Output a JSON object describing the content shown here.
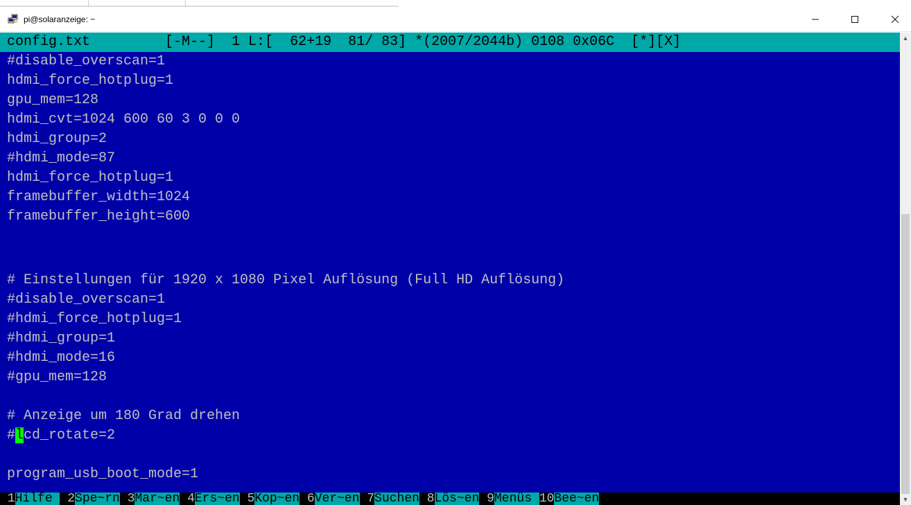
{
  "window": {
    "title": "pi@solaranzeige: ~",
    "app_icon": "putty-icon",
    "buttons": {
      "minimize": "—",
      "maximize": "☐",
      "close": "✕"
    }
  },
  "status_line": "config.txt         [-M--]  1 L:[  62+19  81/ 83] *(2007/2044b) 0108 0x06C  [*][X]",
  "editor_lines": [
    "#disable_overscan=1",
    "hdmi_force_hotplug=1",
    "gpu_mem=128",
    "hdmi_cvt=1024 600 60 3 0 0 0",
    "hdmi_group=2",
    "#hdmi_mode=87",
    "hdmi_force_hotplug=1",
    "framebuffer_width=1024",
    "framebuffer_height=600",
    "",
    "",
    "# Einstellungen für 1920 x 1080 Pixel Auflösung (Full HD Auflösung)",
    "#disable_overscan=1",
    "#hdmi_force_hotplug=1",
    "#hdmi_group=1",
    "#hdmi_mode=16",
    "#gpu_mem=128",
    "",
    "# Anzeige um 180 Grad drehen",
    "#lcd_rotate=2",
    "",
    "program_usb_boot_mode=1"
  ],
  "cursor_line": {
    "before": "#",
    "cursor_char": "l",
    "after": "cd_rotate=2"
  },
  "function_keys": [
    {
      "num": " 1",
      "label": "Hilfe "
    },
    {
      "num": " 2",
      "label": "Spe~rn"
    },
    {
      "num": " 3",
      "label": "Mar~en"
    },
    {
      "num": " 4",
      "label": "Ers~en"
    },
    {
      "num": " 5",
      "label": "Kop~en"
    },
    {
      "num": " 6",
      "label": "Ver~en"
    },
    {
      "num": " 7",
      "label": "Suchen"
    },
    {
      "num": " 8",
      "label": "Lös~en"
    },
    {
      "num": " 9",
      "label": "Menüs "
    },
    {
      "num": "10",
      "label": "Bee~en"
    }
  ],
  "colors": {
    "terminal_bg": "#0000a8",
    "text": "#c0c0c0",
    "status_bg": "#00a8a8",
    "cursor_bg": "#00ff00"
  }
}
